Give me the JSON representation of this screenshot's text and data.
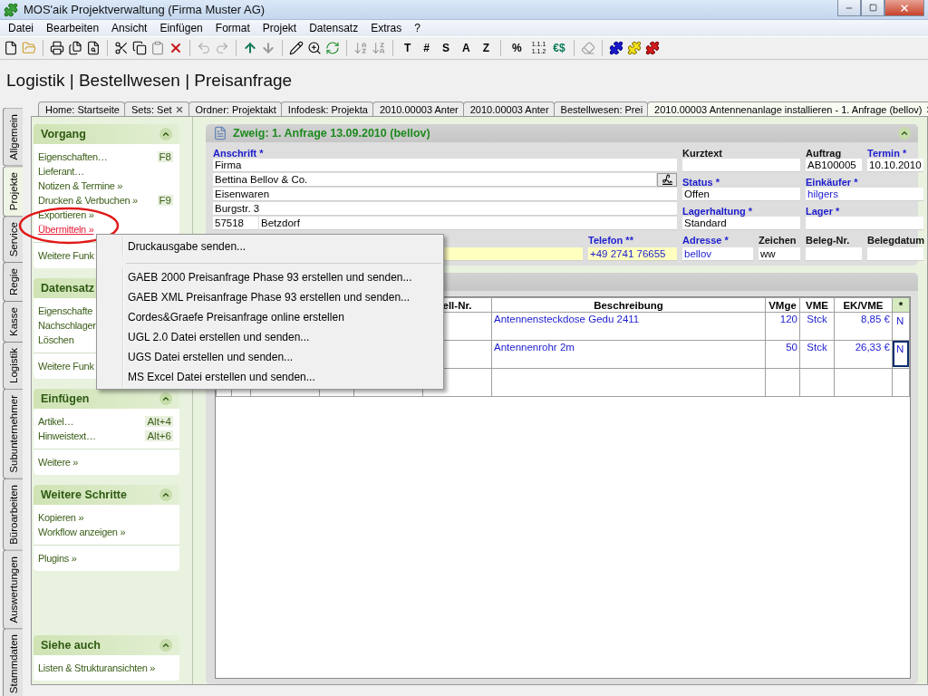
{
  "window": {
    "title": "MOS'aik Projektverwaltung (Firma Muster AG)"
  },
  "menu_bar": [
    "Datei",
    "Bearbeiten",
    "Ansicht",
    "Einfügen",
    "Format",
    "Projekt",
    "Datensatz",
    "Extras",
    "?"
  ],
  "toolbar": {
    "letter_buttons": [
      "T",
      "#",
      "S",
      "A",
      "Z"
    ],
    "percent_button": "%",
    "numbering_button": [
      "1.1.1",
      "1.1.2"
    ],
    "currency_button": "€$"
  },
  "breadcrumb": "Logistik | Bestellwesen | Preisanfrage",
  "side_tabs": [
    {
      "label": "Allgemein",
      "selected": false
    },
    {
      "label": "Projekte",
      "selected": true
    },
    {
      "label": "Service",
      "selected": false
    },
    {
      "label": "Regie",
      "selected": false
    },
    {
      "label": "Kasse",
      "selected": false
    },
    {
      "label": "Logistik",
      "selected": false
    },
    {
      "label": "Subunternehmer",
      "selected": false
    },
    {
      "label": "Büroarbeiten",
      "selected": false
    },
    {
      "label": "Auswertungen",
      "selected": false
    },
    {
      "label": "Stammdaten",
      "selected": false
    }
  ],
  "doc_tabs": [
    {
      "label": "Home: Startseite",
      "selected": false,
      "closable": false
    },
    {
      "label": "Sets: Set",
      "selected": false,
      "closable": true
    },
    {
      "label": "Ordner: Projektakt",
      "selected": false,
      "closable": false
    },
    {
      "label": "Infodesk: Projekta",
      "selected": false,
      "closable": false
    },
    {
      "label": "2010.00003 Anter",
      "selected": false,
      "closable": false
    },
    {
      "label": "2010.00003 Anter",
      "selected": false,
      "closable": false
    },
    {
      "label": "Bestellwesen: Prei",
      "selected": false,
      "closable": false
    },
    {
      "label": "2010.00003 Antennenanlage installieren - 1. Anfrage (bellov)",
      "selected": true,
      "closable": true
    }
  ],
  "task_panel": [
    {
      "title": "Vorgang",
      "groups": [
        [
          {
            "label": "Eigenschaften…",
            "shortcut": "F8",
            "highlighted": false
          },
          {
            "label": "Lieferant…",
            "highlighted": false
          },
          {
            "label": "Notizen & Termine »",
            "highlighted": false
          },
          {
            "label": "Drucken & Verbuchen »",
            "shortcut": "F9",
            "highlighted": false
          },
          {
            "label": "Exportieren »",
            "highlighted": false
          },
          {
            "label": "Übermitteln »",
            "highlighted": true
          }
        ],
        [
          {
            "label": "Weitere Funk",
            "highlighted": false
          }
        ]
      ]
    },
    {
      "title": "Datensatz",
      "groups": [
        [
          {
            "label": "Eigenschafte",
            "highlighted": false
          },
          {
            "label": "Nachschlager",
            "highlighted": false
          },
          {
            "label": "Löschen",
            "highlighted": false
          }
        ],
        [
          {
            "label": "Weitere Funk",
            "highlighted": false
          }
        ]
      ]
    },
    {
      "title": "Einfügen",
      "groups": [
        [
          {
            "label": "Artikel…",
            "shortcut": "Alt+4",
            "highlighted": false
          },
          {
            "label": "Hinweistext…",
            "shortcut": "Alt+6",
            "highlighted": false
          }
        ],
        [
          {
            "label": "Weitere »",
            "highlighted": false
          }
        ]
      ]
    },
    {
      "title": "Weitere Schritte",
      "groups": [
        [
          {
            "label": "Kopieren »",
            "highlighted": false
          },
          {
            "label": "Workflow anzeigen »",
            "highlighted": false
          }
        ],
        [
          {
            "label": "Plugins »",
            "highlighted": false
          }
        ]
      ]
    },
    {
      "title": "Siehe auch",
      "groups": [
        [
          {
            "label": "Listen & Strukturansichten »",
            "highlighted": false
          }
        ]
      ]
    }
  ],
  "header_form": {
    "title": "Zweig: 1. Anfrage 13.09.2010 (bellov)",
    "address": {
      "label": "Anschrift *",
      "lines": [
        "Firma",
        "Bettina Bellov & Co.",
        "Eisenwaren",
        "Burgstr. 3"
      ],
      "zip": "57518",
      "city": "Betzdorf"
    },
    "fields": [
      {
        "label": "Kurztext",
        "required": false,
        "highlighted": false
      },
      {
        "label": "Auftrag",
        "value": "AB100005",
        "required": false,
        "linked": false,
        "highlighted": false
      },
      {
        "label": "Termin *",
        "value": "10.10.2010",
        "required": true,
        "linked": false,
        "highlighted": false
      },
      {
        "label": "Status *",
        "value": "Offen",
        "required": true,
        "linked": false,
        "highlighted": false
      },
      {
        "label": "Einkäufer *",
        "value": "hilgers",
        "required": true,
        "linked": true,
        "highlighted": false
      },
      {
        "label": "Lagerhaltung *",
        "value": "Standard",
        "required": true,
        "linked": false,
        "highlighted": false
      },
      {
        "label": "Lager *",
        "required": true,
        "highlighted": false
      },
      {
        "highlighted": true
      },
      {
        "label": "Telefon **",
        "value": "+49 2741 76655",
        "required": true,
        "linked": true,
        "highlighted": true
      },
      {
        "label": "Adresse *",
        "value": "bellov",
        "required": true,
        "linked": true,
        "highlighted": false
      },
      {
        "label": "Zeichen",
        "value": "ww",
        "required": false,
        "linked": false,
        "highlighted": false
      },
      {
        "label": "Beleg-Nr.",
        "required": false,
        "highlighted": false
      },
      {
        "label": "Belegdatum",
        "required": false,
        "highlighted": false
      }
    ]
  },
  "table": {
    "columns": [
      "ell-Nr.",
      "Beschreibung",
      "VMge",
      "VME",
      "EK/VME",
      "*"
    ],
    "rows": [
      {
        "beschreibung": "Antennensteckdose Gedu 2411",
        "vmge": "120",
        "vme": "Stck",
        "ek_vme": "8,85 €",
        "flag": "N",
        "flag_focused": false
      },
      {
        "beschreibung": "Antennenrohr 2m",
        "vmge": "50",
        "vme": "Stck",
        "ek_vme": "26,33 €",
        "flag": "N",
        "flag_focused": true
      }
    ]
  },
  "context_menu": {
    "groups": [
      [
        "Druckausgabe senden..."
      ],
      [
        "GAEB 2000 Preisanfrage Phase 93 erstellen und senden...",
        "GAEB XML Preisanfrage Phase 93 erstellen und senden...",
        "Cordes&Graefe Preisanfrage online erstellen",
        "UGL 2.0 Datei erstellen und senden...",
        "UGS Datei erstellen und senden...",
        "MS Excel Datei erstellen und senden..."
      ]
    ]
  }
}
